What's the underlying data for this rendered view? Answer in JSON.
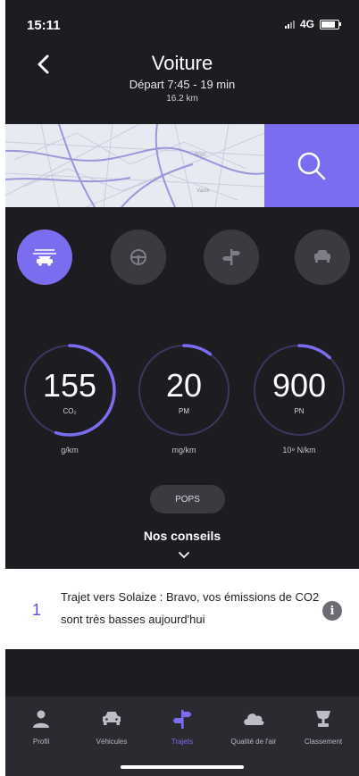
{
  "status": {
    "time": "15:11",
    "network": "4G"
  },
  "header": {
    "title": "Voiture",
    "subtitle": "Départ  7:45 - 19 min",
    "distance": "16.2 km"
  },
  "map": {
    "labels": [
      "Bron",
      "Vaulx"
    ]
  },
  "modes": [
    {
      "name": "car-fast",
      "active": true
    },
    {
      "name": "steering",
      "active": false
    },
    {
      "name": "signpost",
      "active": false
    },
    {
      "name": "car",
      "active": false
    }
  ],
  "gauges": [
    {
      "value": "155",
      "sub": "CO₂",
      "unit": "g/km",
      "level": 0.55
    },
    {
      "value": "20",
      "sub": "PM",
      "unit": "mg/km",
      "level": 0.1
    },
    {
      "value": "900",
      "sub": "PN",
      "unit": "10⁹ N/km",
      "level": 0.12
    }
  ],
  "pops_label": "POPS",
  "conseils_title": "Nos conseils",
  "tip": {
    "number": "1",
    "text": "Trajet vers Solaize : Bravo, vos émissions de CO2 sont très basses aujourd'hui",
    "info": "i"
  },
  "tabs": [
    {
      "label": "Profil",
      "icon": "person-icon",
      "active": false
    },
    {
      "label": "Véhicules",
      "icon": "car-icon",
      "active": false
    },
    {
      "label": "Trajets",
      "icon": "signpost-icon",
      "active": true
    },
    {
      "label": "Qualité de l'air",
      "icon": "cloud-icon",
      "active": false
    },
    {
      "label": "Classement",
      "icon": "trophy-icon",
      "active": false
    }
  ],
  "colors": {
    "accent": "#7a6df0",
    "background": "#1c1c21"
  }
}
